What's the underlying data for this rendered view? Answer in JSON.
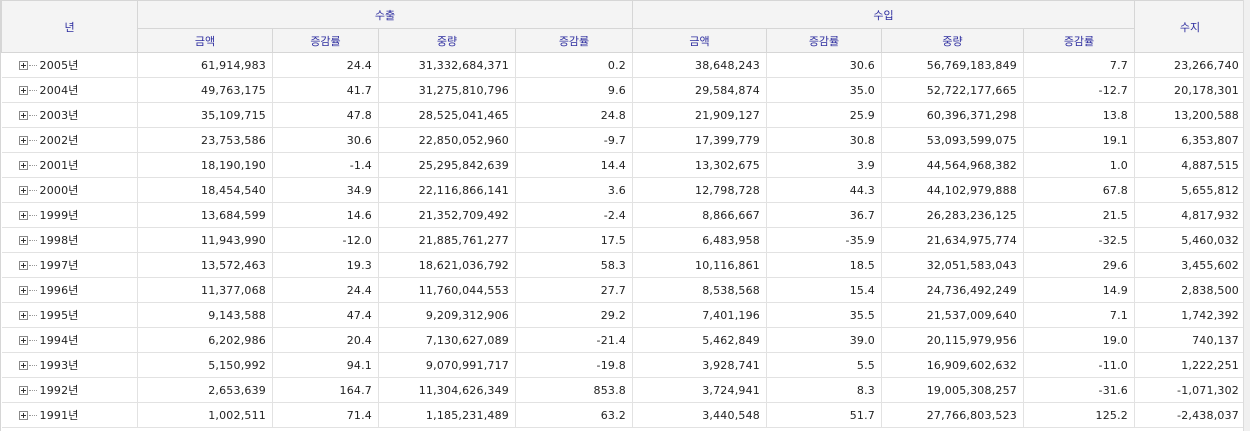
{
  "header": {
    "year": "년",
    "export_group": "수출",
    "import_group": "수입",
    "balance": "수지",
    "export_cols": [
      "금액",
      "증감률",
      "중량",
      "증감률"
    ],
    "import_cols": [
      "금액",
      "증감률",
      "중량",
      "증감률"
    ]
  },
  "rows": [
    {
      "year": "2005년",
      "ex_amt": "61,914,983",
      "ex_rate": "24.4",
      "ex_wt": "31,332,684,371",
      "ex_wt_rate": "0.2",
      "im_amt": "38,648,243",
      "im_rate": "30.6",
      "im_wt": "56,769,183,849",
      "im_wt_rate": "7.7",
      "bal": "23,266,740"
    },
    {
      "year": "2004년",
      "ex_amt": "49,763,175",
      "ex_rate": "41.7",
      "ex_wt": "31,275,810,796",
      "ex_wt_rate": "9.6",
      "im_amt": "29,584,874",
      "im_rate": "35.0",
      "im_wt": "52,722,177,665",
      "im_wt_rate": "-12.7",
      "bal": "20,178,301"
    },
    {
      "year": "2003년",
      "ex_amt": "35,109,715",
      "ex_rate": "47.8",
      "ex_wt": "28,525,041,465",
      "ex_wt_rate": "24.8",
      "im_amt": "21,909,127",
      "im_rate": "25.9",
      "im_wt": "60,396,371,298",
      "im_wt_rate": "13.8",
      "bal": "13,200,588"
    },
    {
      "year": "2002년",
      "ex_amt": "23,753,586",
      "ex_rate": "30.6",
      "ex_wt": "22,850,052,960",
      "ex_wt_rate": "-9.7",
      "im_amt": "17,399,779",
      "im_rate": "30.8",
      "im_wt": "53,093,599,075",
      "im_wt_rate": "19.1",
      "bal": "6,353,807"
    },
    {
      "year": "2001년",
      "ex_amt": "18,190,190",
      "ex_rate": "-1.4",
      "ex_wt": "25,295,842,639",
      "ex_wt_rate": "14.4",
      "im_amt": "13,302,675",
      "im_rate": "3.9",
      "im_wt": "44,564,968,382",
      "im_wt_rate": "1.0",
      "bal": "4,887,515"
    },
    {
      "year": "2000년",
      "ex_amt": "18,454,540",
      "ex_rate": "34.9",
      "ex_wt": "22,116,866,141",
      "ex_wt_rate": "3.6",
      "im_amt": "12,798,728",
      "im_rate": "44.3",
      "im_wt": "44,102,979,888",
      "im_wt_rate": "67.8",
      "bal": "5,655,812"
    },
    {
      "year": "1999년",
      "ex_amt": "13,684,599",
      "ex_rate": "14.6",
      "ex_wt": "21,352,709,492",
      "ex_wt_rate": "-2.4",
      "im_amt": "8,866,667",
      "im_rate": "36.7",
      "im_wt": "26,283,236,125",
      "im_wt_rate": "21.5",
      "bal": "4,817,932"
    },
    {
      "year": "1998년",
      "ex_amt": "11,943,990",
      "ex_rate": "-12.0",
      "ex_wt": "21,885,761,277",
      "ex_wt_rate": "17.5",
      "im_amt": "6,483,958",
      "im_rate": "-35.9",
      "im_wt": "21,634,975,774",
      "im_wt_rate": "-32.5",
      "bal": "5,460,032"
    },
    {
      "year": "1997년",
      "ex_amt": "13,572,463",
      "ex_rate": "19.3",
      "ex_wt": "18,621,036,792",
      "ex_wt_rate": "58.3",
      "im_amt": "10,116,861",
      "im_rate": "18.5",
      "im_wt": "32,051,583,043",
      "im_wt_rate": "29.6",
      "bal": "3,455,602"
    },
    {
      "year": "1996년",
      "ex_amt": "11,377,068",
      "ex_rate": "24.4",
      "ex_wt": "11,760,044,553",
      "ex_wt_rate": "27.7",
      "im_amt": "8,538,568",
      "im_rate": "15.4",
      "im_wt": "24,736,492,249",
      "im_wt_rate": "14.9",
      "bal": "2,838,500"
    },
    {
      "year": "1995년",
      "ex_amt": "9,143,588",
      "ex_rate": "47.4",
      "ex_wt": "9,209,312,906",
      "ex_wt_rate": "29.2",
      "im_amt": "7,401,196",
      "im_rate": "35.5",
      "im_wt": "21,537,009,640",
      "im_wt_rate": "7.1",
      "bal": "1,742,392"
    },
    {
      "year": "1994년",
      "ex_amt": "6,202,986",
      "ex_rate": "20.4",
      "ex_wt": "7,130,627,089",
      "ex_wt_rate": "-21.4",
      "im_amt": "5,462,849",
      "im_rate": "39.0",
      "im_wt": "20,115,979,956",
      "im_wt_rate": "19.0",
      "bal": "740,137"
    },
    {
      "year": "1993년",
      "ex_amt": "5,150,992",
      "ex_rate": "94.1",
      "ex_wt": "9,070,991,717",
      "ex_wt_rate": "-19.8",
      "im_amt": "3,928,741",
      "im_rate": "5.5",
      "im_wt": "16,909,602,632",
      "im_wt_rate": "-11.0",
      "bal": "1,222,251"
    },
    {
      "year": "1992년",
      "ex_amt": "2,653,639",
      "ex_rate": "164.7",
      "ex_wt": "11,304,626,349",
      "ex_wt_rate": "853.8",
      "im_amt": "3,724,941",
      "im_rate": "8.3",
      "im_wt": "19,005,308,257",
      "im_wt_rate": "-31.6",
      "bal": "-1,071,302"
    },
    {
      "year": "1991년",
      "ex_amt": "1,002,511",
      "ex_rate": "71.4",
      "ex_wt": "1,185,231,489",
      "ex_wt_rate": "63.2",
      "im_amt": "3,440,548",
      "im_rate": "51.7",
      "im_wt": "27,766,803,523",
      "im_wt_rate": "125.2",
      "bal": "-2,438,037"
    }
  ]
}
